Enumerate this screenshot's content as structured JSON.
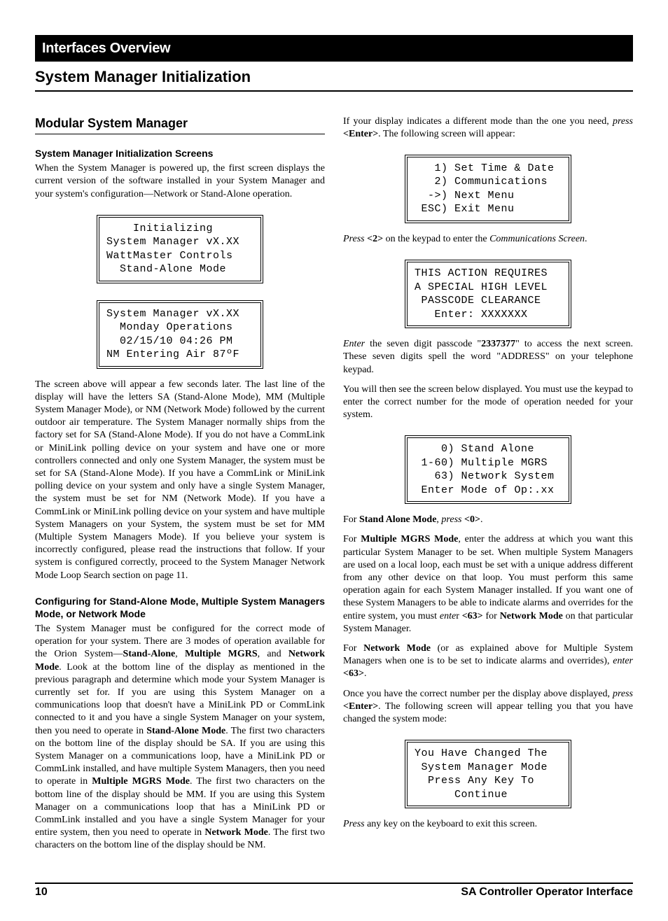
{
  "header": {
    "bar": "Interfaces Overview",
    "title": "System Manager Initialization"
  },
  "left": {
    "h2": "Modular System Manager",
    "h3a": "System Manager Initialization Screens",
    "p1": "When the System Manager is powered up, the first screen displays the current version of the software installed in your System Manager and your system's configuration—Network or Stand-Alone operation.",
    "lcd1": "    Initializing\nSystem Manager vX.XX\nWattMaster Controls\n  Stand-Alone Mode",
    "lcd2": "System Manager vX.XX\n  Monday Operations\n  02/15/10 04:26 PM\nNM Entering Air 87ºF",
    "p2": "The screen above will appear a few seconds later. The last line of the display will have the letters SA (Stand-Alone Mode), MM (Multiple System Manager Mode), or NM (Network Mode) followed by the current outdoor air temperature.  The System Manager normally ships from the factory set for SA (Stand-Alone Mode). If you do not have a CommLink or MiniLink polling device on your system and have one or more controllers connected and only one System Manager, the system must be set for SA (Stand-Alone Mode). If you have a CommLink or MiniLink polling device on your system and only have a single System Manager, the system must be set for  NM (Network Mode). If you have a CommLink or MiniLink polling device on your system and have multiple System Managers on your System, the system must be set for MM (Multiple System Managers Mode). If you believe your system is incorrectly configured, please read the instructions that follow. If your system is configured correctly, proceed to the System Manager Network Mode Loop Search section on page 11.",
    "h3b": "Configuring for Stand-Alone Mode, Multiple System Managers Mode, or Network Mode",
    "p3_a": "The System Manager must be configured for the correct mode of operation for your system. There are 3 modes of operation available for the Orion System—",
    "p3_b1": "Stand-Alone",
    "p3_c1": ", ",
    "p3_b2": "Multiple MGRS",
    "p3_c2": ", and ",
    "p3_b3": "Network Mode",
    "p3_d": ". Look at the bottom line of the display as mentioned in the previous paragraph and determine which mode your System Manager is currently set for. If you are using this System Manager on a communications loop that doesn't have a MiniLink PD or CommLink connected to it and you have a single System Manager on your system, then you need to operate in ",
    "p3_b4": "Stand-Alone Mode",
    "p3_e": ". The first two characters on the bottom line of the display should be SA. If you are using this System Manager on a communications loop, have a MiniLink PD or CommLink installed, and have multiple System Managers, then you need to operate in ",
    "p3_b5": "Multiple MGRS Mode",
    "p3_f": ". The first two characters on the bottom line of the display should be MM. If you are using this System Manager on a communications loop that has a MiniLink PD or CommLink installed and you have a single System Manager for your entire system, then you need to operate in ",
    "p3_b6": "Network Mode",
    "p3_g": ". The first two characters on the bottom line of the display should be NM."
  },
  "right": {
    "p1_a": "If your display indicates a different mode than the one you need, ",
    "p1_i": "press",
    "p1_b": " ",
    "p1_bold": "<Enter>",
    "p1_c": ". The following screen will appear:",
    "lcd3": "   1) Set Time & Date\n   2) Communications\n  ->) Next Menu\n ESC) Exit Menu",
    "p2_i": "Press",
    "p2_b": " ",
    "p2_bold": "<2>",
    "p2_c": " on the keypad to enter the ",
    "p2_i2": "Communications Screen",
    "p2_d": ".",
    "lcd4": "THIS ACTION REQUIRES\nA SPECIAL HIGH LEVEL\n PASSCODE CLEARANCE\n   Enter: XXXXXXX",
    "p3_i": "Enter",
    "p3_a": " the seven digit passcode \"",
    "p3_bold": "2337377",
    "p3_b": "\" to access the next screen. These seven digits spell the word \"ADDRESS\" on your telephone keypad.",
    "p4": "You will then see the screen below displayed. You must use the keypad to enter the correct number for the mode of operation needed for your system.",
    "lcd5": "    0) Stand Alone\n 1-60) Multiple MGRS\n   63) Network System\n Enter Mode of Op:.xx",
    "p5_a": "For ",
    "p5_bold": "Stand Alone Mode",
    "p5_b": ", ",
    "p5_i": "press",
    "p5_c": " ",
    "p5_bold2": "<0>",
    "p5_d": ".",
    "p6_a": "For ",
    "p6_bold": "Multiple MGRS Mode",
    "p6_b": ", enter the address at which you want this particular System Manager to be set. When  multiple System Managers are used on a local loop, each must be set with a unique address different from any other device on that loop. You must perform this same operation again for each System Manager installed. If you want one of these System Managers to be able to indicate alarms and overrides for the entire system, you must ",
    "p6_i": "ente",
    "p6_r": "r ",
    "p6_bold2": "<63>",
    "p6_c": " for ",
    "p6_bold3": "Network Mode",
    "p6_d": " on that particular System Manager.",
    "p7_a": "For ",
    "p7_bold": "Network Mode",
    "p7_b": " (or as explained above for Multiple System Managers when one is to be set to indicate alarms and overrides), ",
    "p7_i": "enter",
    "p7_c": " ",
    "p7_bold2": "<63>",
    "p7_d": ".",
    "p8_a": "Once you have the correct number per the display above displayed, ",
    "p8_i": "press",
    "p8_b": " ",
    "p8_bold": "<Enter>",
    "p8_c": ". The following screen will appear telling you that you have changed the system mode:",
    "lcd6": "You Have Changed The\n System Manager Mode\n  Press Any Key To\n      Continue",
    "p9_i": "Press",
    "p9_a": " any key on the keyboard to exit this screen."
  },
  "footer": {
    "page": "10",
    "title": "SA Controller Operator Interface"
  }
}
